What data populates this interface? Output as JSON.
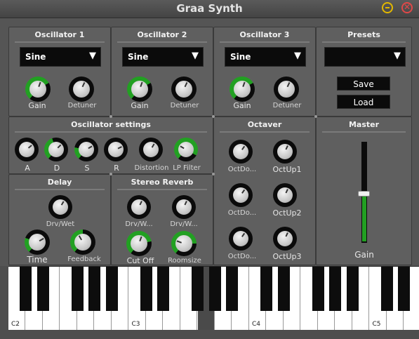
{
  "window": {
    "title": "Graa Synth"
  },
  "oscillators": [
    {
      "title": "Oscillator 1",
      "waveform": "Sine",
      "gain_label": "Gain",
      "detuner_label": "Detuner"
    },
    {
      "title": "Oscillator 2",
      "waveform": "Sine",
      "gain_label": "Gain",
      "detuner_label": "Detuner"
    },
    {
      "title": "Oscillator 3",
      "waveform": "Sine",
      "gain_label": "Gain",
      "detuner_label": "Detuner"
    }
  ],
  "presets": {
    "title": "Presets",
    "selected": "",
    "save_label": "Save",
    "load_label": "Load"
  },
  "osc_settings": {
    "title": "Oscillator settings",
    "knobs": [
      "A",
      "D",
      "S",
      "R",
      "Distortion",
      "LP Filter"
    ]
  },
  "octaver": {
    "title": "Octaver",
    "knobs": [
      "OctDo...",
      "OctUp1",
      "OctDo...",
      "OctUp2",
      "OctDo...",
      "OctUp3"
    ]
  },
  "master": {
    "title": "Master",
    "gain_label": "Gain",
    "gain_level": 0.5
  },
  "delay": {
    "title": "Delay",
    "drywet_label": "Drv/Wet",
    "time_label": "Time",
    "feedback_label": "Feedback"
  },
  "reverb": {
    "title": "Stereo Reverb",
    "drywet1_label": "Drv/W...",
    "drywet2_label": "Drv/W...",
    "cutoff_label": "Cut Off",
    "roomsize_label": "Roomsize"
  },
  "piano": {
    "octave_labels": [
      "C2",
      "C3",
      "C4",
      "C5"
    ]
  },
  "colors": {
    "accent": "#22a022",
    "knob_ring": "#0b0b0b",
    "panel": "#5f5f5f"
  }
}
